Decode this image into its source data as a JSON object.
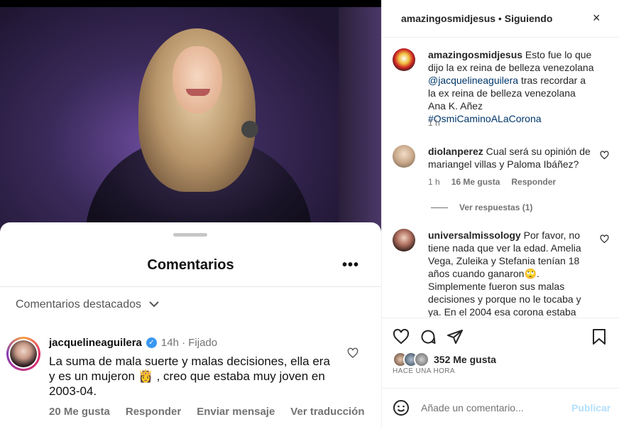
{
  "video": {
    "description_icon": "video-frame"
  },
  "comments_sheet": {
    "title": "Comentarios",
    "more": "•••",
    "filter_label": "Comentarios destacados",
    "comment": {
      "user": "jacquelineaguilera",
      "verified": true,
      "meta": "14h · Fijado",
      "text_before_emoji": "La suma de mala suerte y malas decisiones, ella era y es un mujeron ",
      "emoji": "👸",
      "text_after_emoji": " , creo que estaba muy joven en 2003-04.",
      "likes": "20 Me gusta",
      "reply": "Responder",
      "send": "Enviar mensaje",
      "translate": "Ver traducción"
    }
  },
  "panel": {
    "header_user": "amazingosmidjesus",
    "header_sep": " • ",
    "header_follow": "Siguiendo",
    "close": "×",
    "caption": {
      "user": "amazingosmidjesus",
      "text1": " Esto fue lo que dijo la ex reina de belleza venezolana ",
      "mention": "@jacquelineaguilera",
      "text2": " tras recordar a la ex reina de belleza venezolana Ana K. Añez ",
      "hashtag": "#OsmiCaminoALaCorona",
      "time": "1 h"
    },
    "comment1": {
      "user": "diolanperez",
      "text": " Cual será su opinión de mariangel villas y Paloma Ibáñez?",
      "time": "1 h",
      "likes": "16 Me gusta",
      "reply": "Responder",
      "view_replies": "Ver respuestas (1)"
    },
    "comment2": {
      "user": "universalmissology",
      "text": " Por favor, no tiene nada que ver la edad. Amelia Vega, Zuleika y Stefania tenían 18 años cuando ganaron🙄. Simplemente fueron sus malas decisiones y porque no le tocaba y ya. En el 2004 esa corona estaba"
    },
    "likes": "352 Me gusta",
    "when": "HACE UNA HORA",
    "add_placeholder": "Añade un comentario...",
    "publish": "Publicar"
  }
}
